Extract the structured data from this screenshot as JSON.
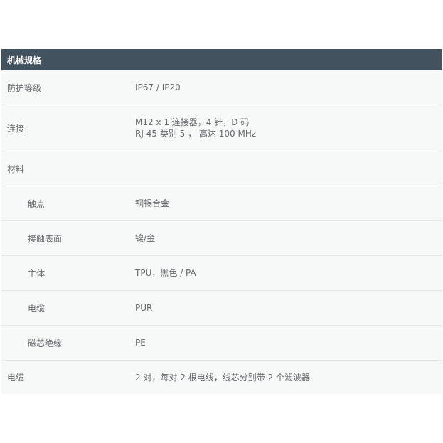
{
  "section": {
    "title": "机械规格"
  },
  "rows": [
    {
      "label": "防护等级",
      "values": [
        "IP67 / IP20"
      ]
    },
    {
      "label": "连接",
      "values": [
        "M12 x 1 连接器，4 针，D 码",
        "RJ-45 类别 5 ， 高达 100 MHz"
      ]
    },
    {
      "label": "材料",
      "values": []
    },
    {
      "label": "触点",
      "values": [
        "铜锡合金"
      ]
    },
    {
      "label": "接触表面",
      "values": [
        "镍/金"
      ]
    },
    {
      "label": "主体",
      "values": [
        "TPU，黑色 / PA"
      ]
    },
    {
      "label": "电缆",
      "values": [
        "PUR"
      ]
    },
    {
      "label": "磁芯绝缘",
      "values": [
        "PE"
      ]
    },
    {
      "label": "电缆",
      "values": [
        "2 对，每对 2 根电线，线芯分别带 2 个滤波器"
      ]
    }
  ]
}
